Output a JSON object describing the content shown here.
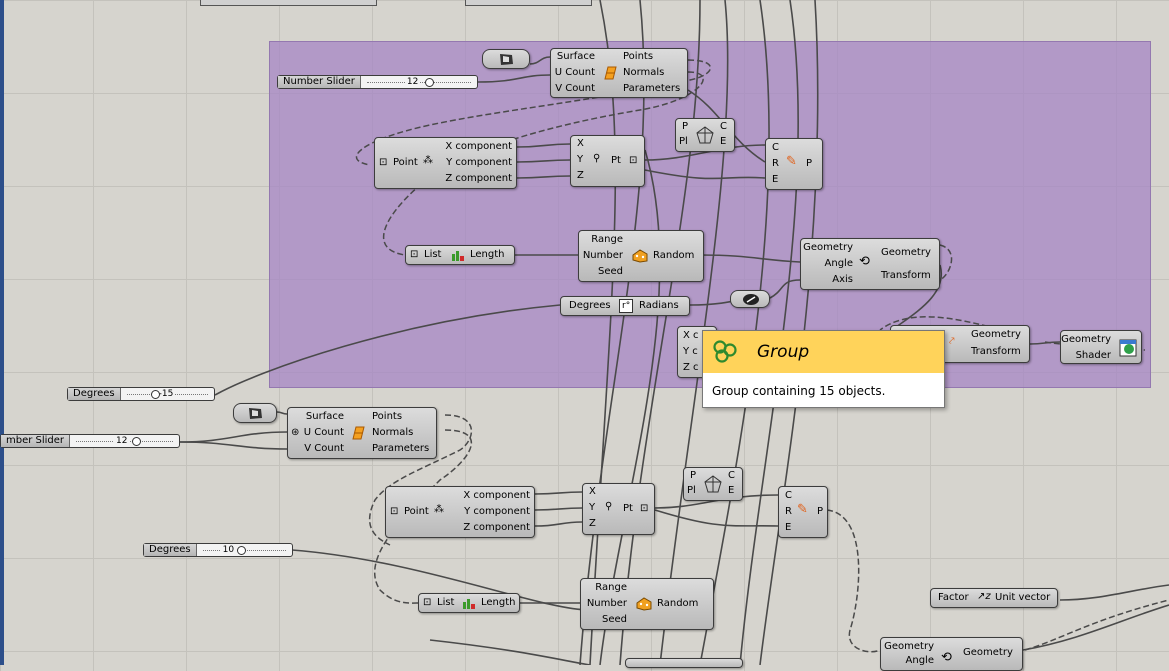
{
  "group": {
    "tooltip": {
      "title": "Group",
      "description": "Group containing 15 objects.",
      "icon": "group-icon"
    }
  },
  "sliders": {
    "top_number": {
      "name": "Number Slider",
      "value": "12"
    },
    "top_degrees": {
      "name": "Degrees",
      "value": "-15"
    },
    "bottom_number": {
      "name": "mber Slider",
      "value": "12"
    },
    "bottom_degrees": {
      "name": "Degrees",
      "value": "10"
    }
  },
  "components": {
    "top_divide_surface": {
      "inputs": [
        "Surface",
        "U Count",
        "V Count"
      ],
      "outputs": [
        "Points",
        "Normals",
        "Parameters"
      ]
    },
    "top_deconstruct": {
      "label": "Point",
      "outputs": [
        "X component",
        "Y component",
        "Z component"
      ]
    },
    "top_construct": {
      "inputs": [
        "X",
        "Y",
        "Z"
      ],
      "label": "Pt"
    },
    "top_closest": {
      "inputs": [
        "P",
        "Pl"
      ],
      "outputs": [
        "C",
        "E"
      ]
    },
    "top_line": {
      "inputs": [
        "C",
        "R",
        "E"
      ],
      "outputs": [
        "P"
      ]
    },
    "top_list": {
      "label": "List",
      "output": "Length"
    },
    "top_random": {
      "inputs": [
        "Range",
        "Number",
        "Seed"
      ],
      "output": "Random"
    },
    "top_radians": {
      "input": "Degrees",
      "output": "Radians"
    },
    "top_rotate": {
      "inputs": [
        "Geometry",
        "Angle",
        "Axis"
      ],
      "outputs": [
        "Geometry",
        "Transform"
      ]
    },
    "top_partial_xyz": {
      "inputs": [
        "X c",
        "Y c",
        "Z c"
      ]
    },
    "top_transform": {
      "outputs": [
        "Geometry",
        "Transform"
      ]
    },
    "top_display": {
      "inputs": [
        "Geometry",
        "Shader"
      ]
    },
    "bottom_divide_surface": {
      "inputs": [
        "Surface",
        "U Count",
        "V Count"
      ],
      "outputs": [
        "Points",
        "Normals",
        "Parameters"
      ]
    },
    "bottom_deconstruct": {
      "label": "Point",
      "outputs": [
        "X component",
        "Y component",
        "Z component"
      ]
    },
    "bottom_construct": {
      "inputs": [
        "X",
        "Y",
        "Z"
      ],
      "label": "Pt"
    },
    "bottom_closest": {
      "inputs": [
        "P",
        "Pl"
      ],
      "outputs": [
        "C",
        "E"
      ]
    },
    "bottom_line": {
      "inputs": [
        "C",
        "R",
        "E"
      ],
      "outputs": [
        "P"
      ]
    },
    "bottom_list": {
      "label": "List",
      "output": "Length"
    },
    "bottom_random": {
      "inputs": [
        "Range",
        "Number",
        "Seed"
      ],
      "output": "Random"
    },
    "bottom_unit": {
      "input": "Factor",
      "output": "Unit vector"
    },
    "bottom_rotate": {
      "inputs": [
        "Geometry",
        "Angle"
      ],
      "outputs": [
        "Geometry"
      ]
    }
  },
  "colors": {
    "canvas": "#d6d4ce",
    "group_fill": "#a685c4",
    "tooltip_header": "#ffd35a",
    "component": "#c8c8c8"
  }
}
